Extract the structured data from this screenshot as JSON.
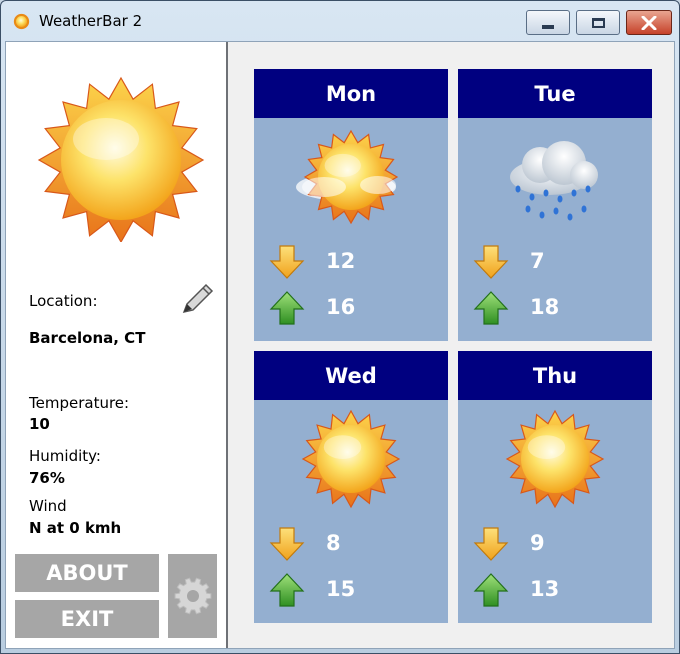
{
  "window": {
    "title": "WeatherBar 2"
  },
  "sidebar": {
    "location_label": "Location:",
    "location_value": "Barcelona, CT",
    "temperature_label": "Temperature:",
    "temperature_value": "10",
    "humidity_label": "Humidity:",
    "humidity_value": "76%",
    "wind_label": "Wind",
    "wind_value": "N at 0 kmh",
    "about_label": "ABOUT",
    "exit_label": "EXIT",
    "current_icon": "sun-icon",
    "settings_icon": "gear-icon"
  },
  "forecast": [
    {
      "day": "Mon",
      "icon": "partly-cloudy-sun-icon",
      "low": "12",
      "high": "16"
    },
    {
      "day": "Tue",
      "icon": "rain-cloud-icon",
      "low": "7",
      "high": "18"
    },
    {
      "day": "Wed",
      "icon": "sun-icon",
      "low": "8",
      "high": "15"
    },
    {
      "day": "Thu",
      "icon": "sun-icon",
      "low": "9",
      "high": "13"
    }
  ],
  "colors": {
    "tile_header": "#000080",
    "tile_body": "#94afd0",
    "button_gray": "#a6a6a6",
    "low_arrow": "#f5b324",
    "high_arrow": "#3aa52a"
  }
}
